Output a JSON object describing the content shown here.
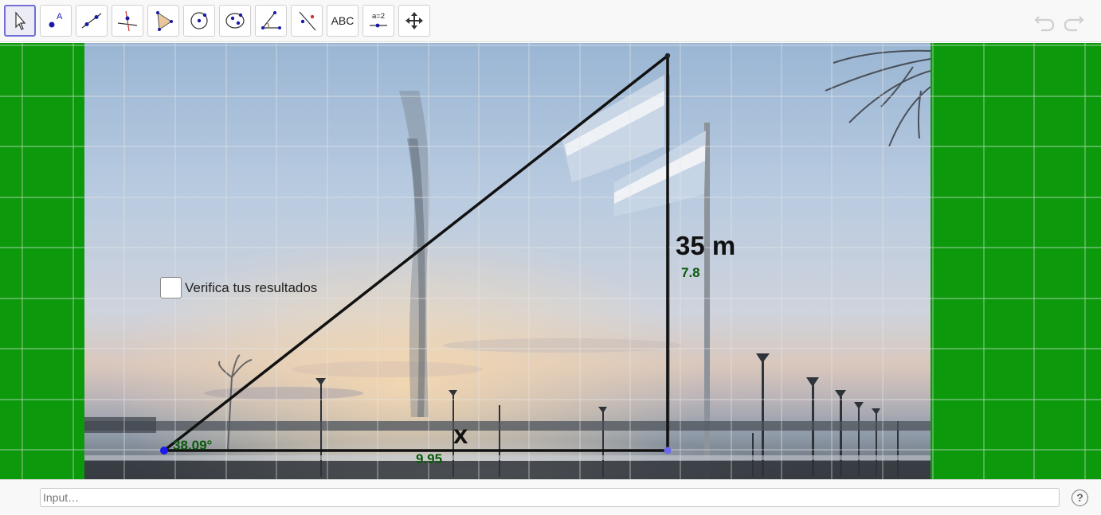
{
  "toolbar": {
    "tools": [
      {
        "name": "move-tool",
        "selected": true
      },
      {
        "name": "point-tool"
      },
      {
        "name": "line-tool"
      },
      {
        "name": "perpendicular-line-tool"
      },
      {
        "name": "polygon-tool"
      },
      {
        "name": "circle-tool"
      },
      {
        "name": "ellipse-tool"
      },
      {
        "name": "angle-tool"
      },
      {
        "name": "reflect-tool"
      },
      {
        "name": "text-tool",
        "label": "ABC"
      },
      {
        "name": "slider-tool",
        "label": "a=2"
      },
      {
        "name": "move-graphics-view-tool"
      }
    ],
    "undo_icon": "undo-icon",
    "redo_icon": "redo-icon"
  },
  "canvas": {
    "checkbox_label": "Verifica tus resultados",
    "height_label": "35 m",
    "base_label": "x",
    "height_value": "7.8",
    "base_value": "9.95",
    "angle_value": "38.09°",
    "background_color": "#0c9a0c"
  },
  "input": {
    "placeholder": "Input…"
  },
  "help_icon": "?"
}
